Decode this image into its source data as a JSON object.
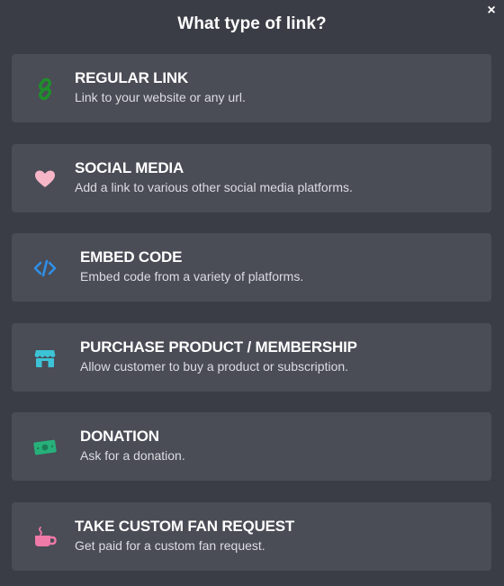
{
  "modal": {
    "title": "What type of link?",
    "close_label": "×"
  },
  "options": [
    {
      "label": "REGULAR LINK",
      "description": "Link to your website or any url.",
      "icon": "link-icon",
      "icon_color": "#1e8f2a"
    },
    {
      "label": "SOCIAL MEDIA",
      "description": "Add a link to various other social media platforms.",
      "icon": "heart-icon",
      "icon_color": "#f7b6c8"
    },
    {
      "label": "EMBED CODE",
      "description": "Embed code from a variety of platforms.",
      "icon": "code-icon",
      "icon_color": "#2f8fe8"
    },
    {
      "label": "PURCHASE PRODUCT / MEMBERSHIP",
      "description": "Allow customer to buy a product or subscription.",
      "icon": "store-icon",
      "icon_color": "#3cc3d6"
    },
    {
      "label": "DONATION",
      "description": "Ask for a donation.",
      "icon": "money-icon",
      "icon_color": "#27b07a"
    },
    {
      "label": "TAKE CUSTOM FAN REQUEST",
      "description": "Get paid for a custom fan request.",
      "icon": "coffee-cup-icon",
      "icon_color": "#f07aa8"
    }
  ]
}
